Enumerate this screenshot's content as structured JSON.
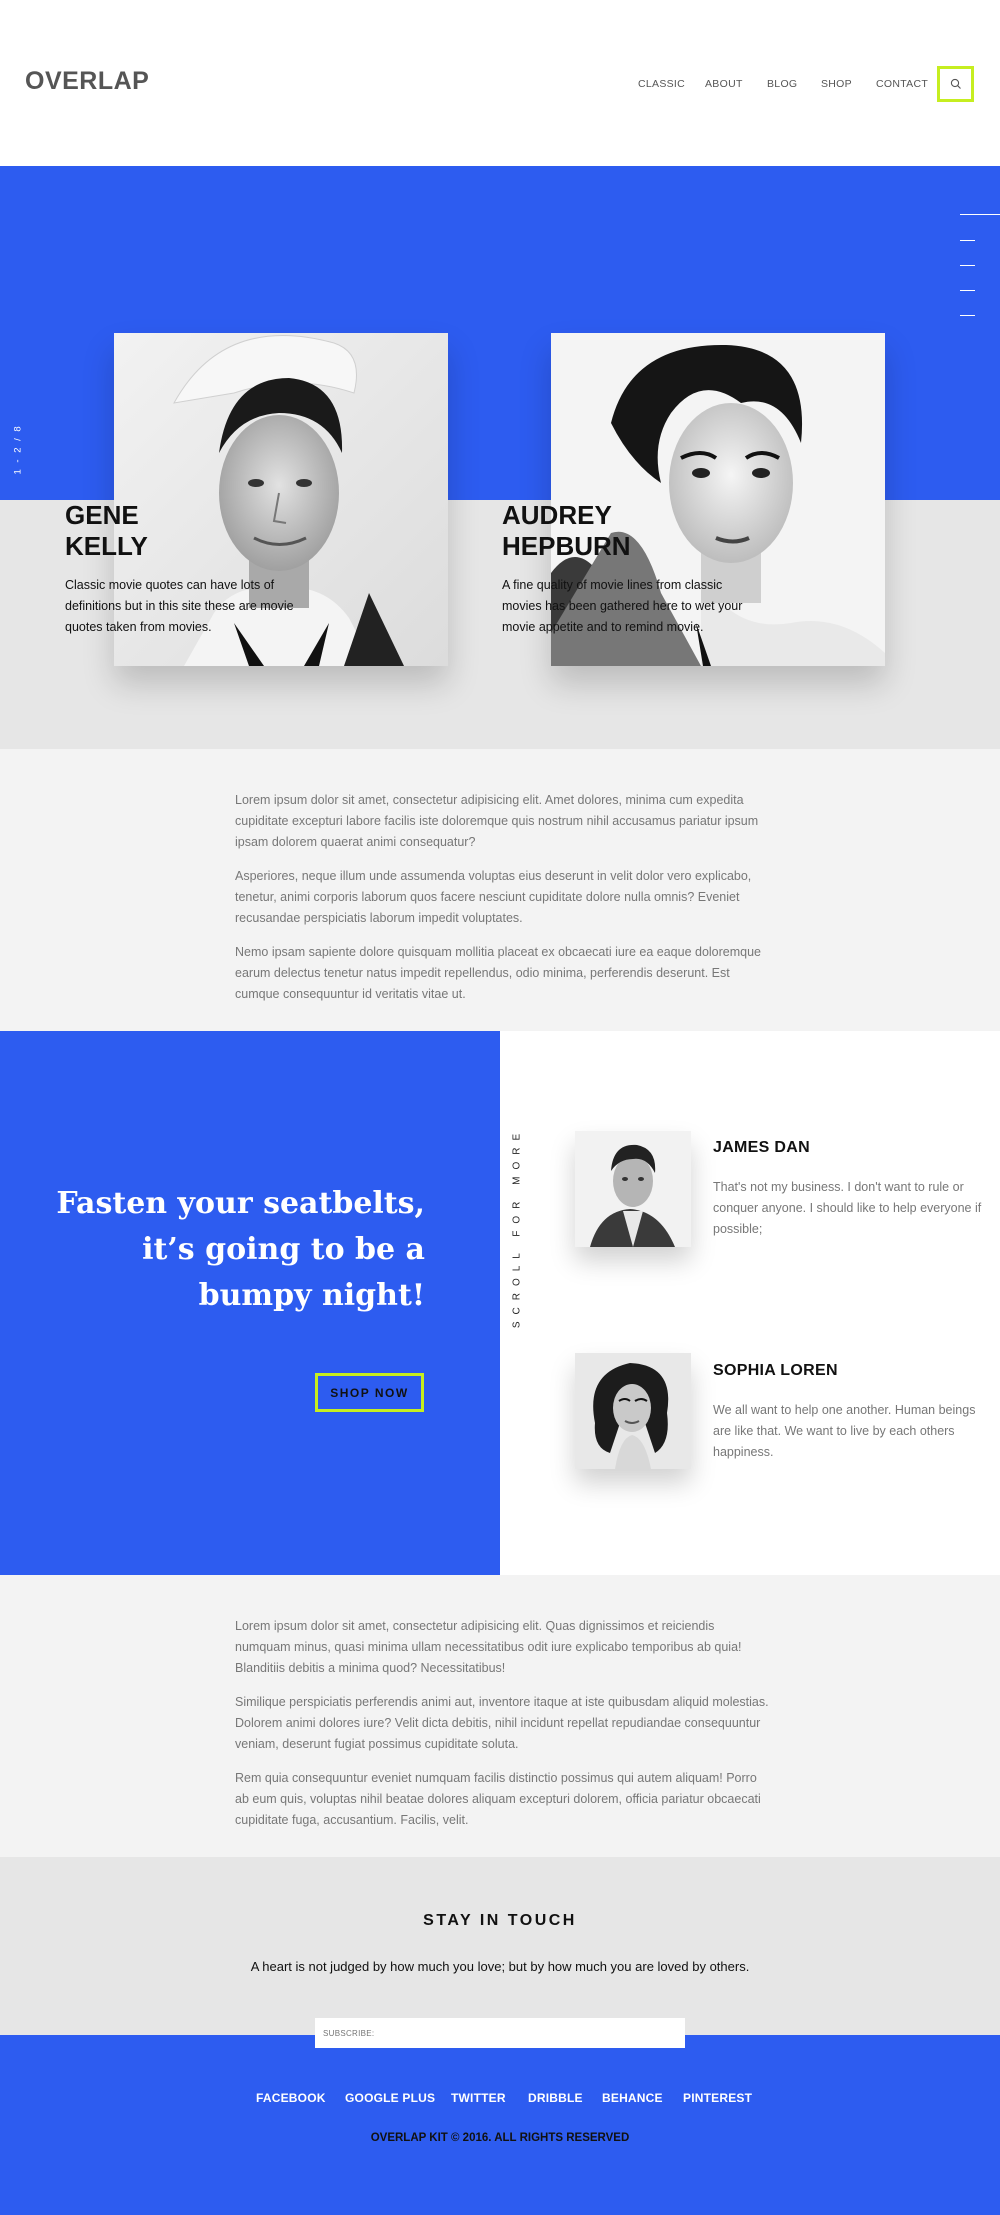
{
  "header": {
    "logo": "OVERLAP",
    "nav": [
      "CLASSIC",
      "ABOUT",
      "BLOG",
      "SHOP",
      "CONTACT"
    ],
    "search_icon": "search-icon"
  },
  "hero": {
    "counter": "1 - 2 / 8",
    "slides": [
      {
        "name_line1": "GENE",
        "name_line2": "KELLY",
        "description": "Classic movie quotes can have lots of definitions but in this site these are movie quotes taken from movies."
      },
      {
        "name_line1": "AUDREY",
        "name_line2": "HEPBURN",
        "description": "A fine quality of movie lines from classic movies has been gathered here to wet your movie appetite and to remind movie."
      }
    ]
  },
  "text_block_1": [
    "Lorem ipsum dolor sit amet, consectetur adipisicing elit. Amet dolores, minima cum expedita cupiditate excepturi labore facilis iste doloremque quis nostrum nihil accusamus pariatur ipsum ipsam dolorem quaerat animi consequatur?",
    "Asperiores, neque illum unde assumenda voluptas eius deserunt in velit dolor vero explicabo, tenetur, animi corporis laborum quos facere nesciunt cupiditate dolore nulla omnis? Eveniet recusandae perspiciatis laborum impedit voluptates.",
    "Nemo ipsam sapiente dolore quisquam mollitia placeat ex obcaecati iure ea eaque doloremque earum delectus tenetur natus impedit repellendus, odio minima, perferendis deserunt. Est cumque consequuntur id veritatis vitae ut."
  ],
  "quote": {
    "line1": "Fasten your seatbelts,",
    "line2": "it’s going to be a",
    "line3": "bumpy night!",
    "button": "SHOP NOW"
  },
  "scroll_label": "SCROLL FOR MORE",
  "people": [
    {
      "name": "JAMES DAN",
      "text": "That's not my business. I don't want to rule or conquer anyone. I should like to help everyone if possible;"
    },
    {
      "name": "SOPHIA LOREN",
      "text": "We all want to help one another. Human beings are like that. We want to live by each others happiness."
    }
  ],
  "text_block_2": [
    "Lorem ipsum dolor sit amet, consectetur adipisicing elit. Quas dignissimos et reiciendis numquam minus, quasi minima ullam necessitatibus odit iure explicabo temporibus ab quia! Blanditiis debitis a minima quod? Necessitatibus!",
    "Similique perspiciatis perferendis animi aut, inventore itaque at iste quibusdam aliquid molestias. Dolorem animi dolores iure? Velit dicta debitis, nihil incidunt repellat repudiandae consequuntur veniam, deserunt fugiat possimus cupiditate soluta.",
    "Rem quia consequuntur eveniet numquam facilis distinctio possimus qui autem aliquam! Porro ab eum quis, voluptas nihil beatae dolores aliquam excepturi dolorem, officia pariatur obcaecati cupiditate fuga, accusantium. Facilis, velit."
  ],
  "touch": {
    "title": "STAY IN TOUCH",
    "quote": "A heart is not judged by how much you love; but by how much you are loved by others.",
    "subscribe_placeholder": "SUBSCRIBE:"
  },
  "footer": {
    "social": [
      "FACEBOOK",
      "GOOGLE PLUS",
      "TWITTER",
      "DRIBBLE",
      "BEHANCE",
      "PINTEREST"
    ],
    "copyright": "OVERLAP KIT © 2016. ALL RIGHTS RESERVED"
  },
  "colors": {
    "accent_blue": "#2d5cf0",
    "highlight_lime": "#c6ee20",
    "gray_bg": "#e6e6e6"
  }
}
